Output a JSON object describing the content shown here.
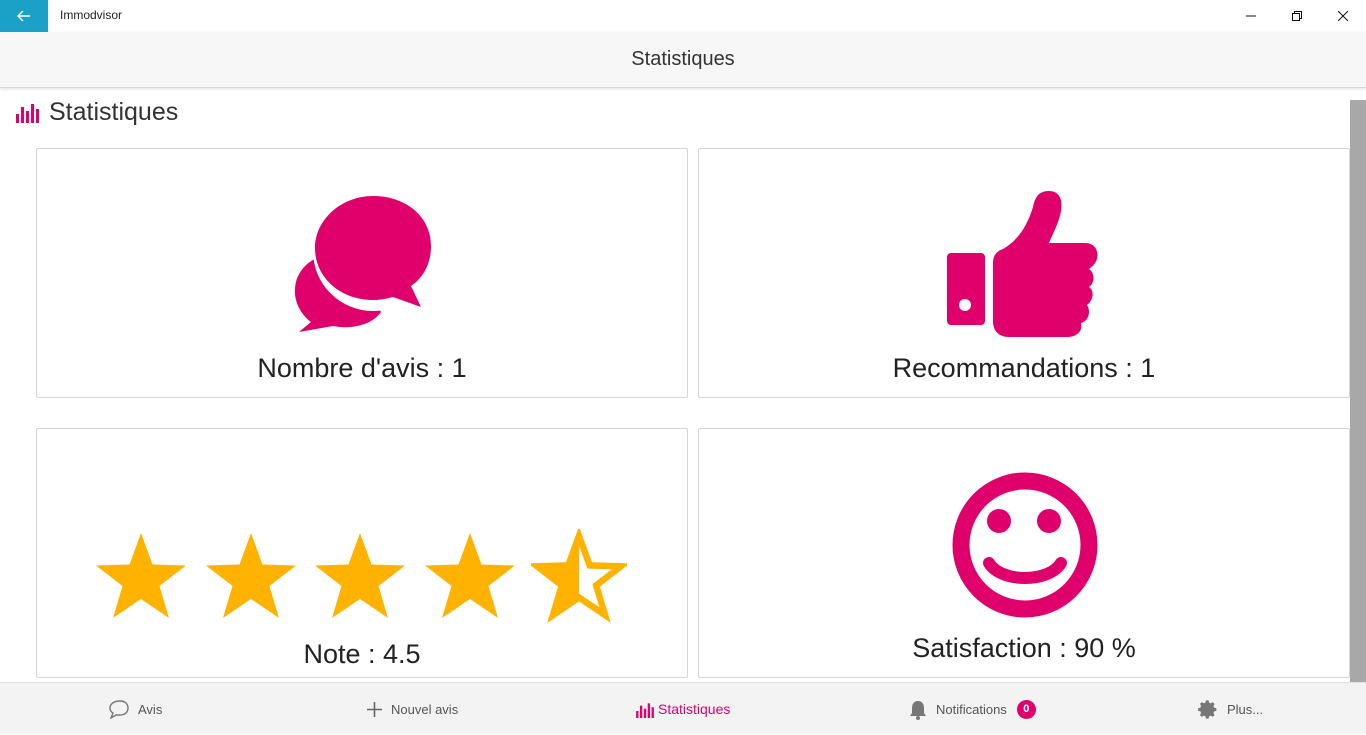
{
  "window": {
    "app_title": "Immodvisor",
    "back_icon": "arrow-left-icon",
    "minimize_icon": "minimize-icon",
    "restore_icon": "restore-icon",
    "close_icon": "close-icon",
    "accent": "#1ba1c8"
  },
  "header": {
    "title": "Statistiques"
  },
  "section": {
    "title": "Statistiques",
    "icon": "bar-chart-icon"
  },
  "brand_color": "#e0006b",
  "star_color": "#ffb300",
  "cards": {
    "reviews": {
      "label": "Nombre d'avis : 1",
      "icon": "chat-bubbles-icon"
    },
    "recommendations": {
      "label": "Recommandations : 1",
      "icon": "thumbs-up-icon"
    },
    "rating": {
      "label": "Note : 4.5",
      "icon": "star-icon",
      "value": 4.5,
      "max": 5
    },
    "satisfaction": {
      "label": "Satisfaction : 90 %",
      "icon": "smiley-icon"
    }
  },
  "bottom_nav": {
    "items": [
      {
        "label": "Avis",
        "icon": "chat-bubble-outline-icon"
      },
      {
        "label": "Nouvel avis",
        "icon": "plus-icon"
      },
      {
        "label": "Statistiques",
        "icon": "bar-chart-icon",
        "active": true
      },
      {
        "label": "Notifications",
        "icon": "bell-icon",
        "badge": "0"
      },
      {
        "label": "Plus...",
        "icon": "gear-icon"
      }
    ]
  }
}
